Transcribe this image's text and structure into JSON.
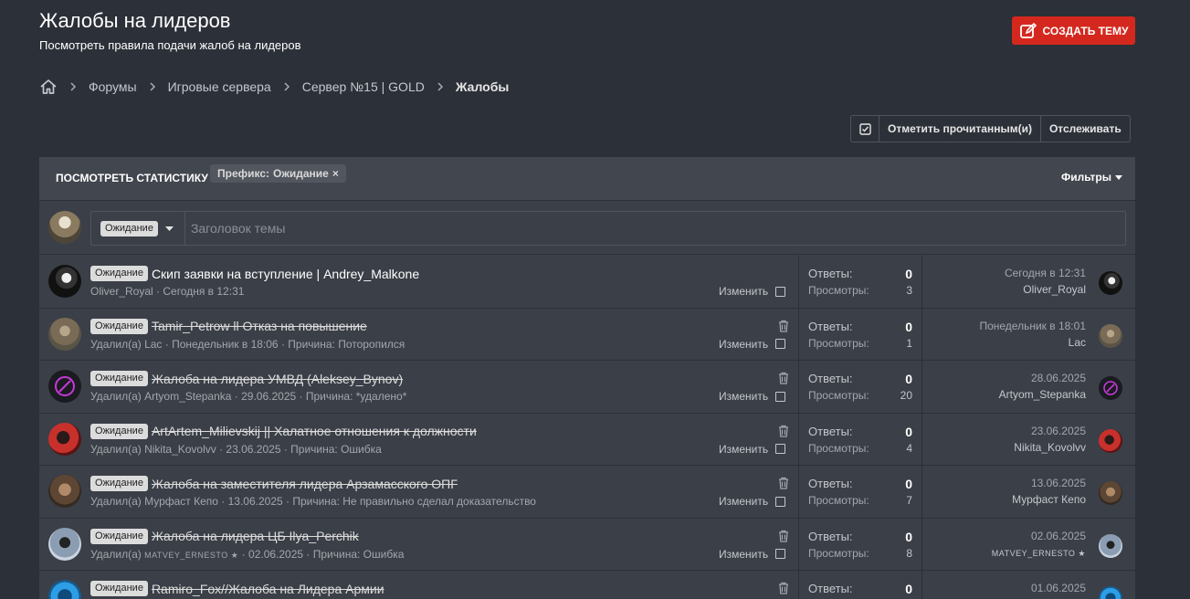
{
  "header": {
    "title": "Жалобы на лидеров",
    "description": "Посмотреть правила подачи жалоб на лидеров",
    "create_button": "СОЗДАТЬ ТЕМУ"
  },
  "breadcrumb": [
    "Форумы",
    "Игровые сервера",
    "Сервер №15 | GOLD",
    "Жалобы"
  ],
  "actions": {
    "mark_read": "Отметить прочитанным(и)",
    "watch": "Отслеживать"
  },
  "filter_bar": {
    "stats_link": "ПОСМОТРЕТЬ СТАТИСТИКУ",
    "prefix_label": "Префикс:",
    "prefix_value": "Ожидание",
    "remove": "×",
    "filters": "Фильтры"
  },
  "new_thread": {
    "prefix": "Ожидание",
    "placeholder": "Заголовок темы"
  },
  "labels": {
    "replies": "Ответы:",
    "views": "Просмотры:",
    "edit": "Изменить"
  },
  "threads": [
    {
      "prefix": "Ожидание",
      "title": "Скип заявки на вступление | Andrey_Malkone",
      "meta": "Oliver_Royal · Сегодня в 12:31",
      "replies": "0",
      "views": "3",
      "last_date": "Сегодня в 12:31",
      "last_user": "Oliver_Royal"
    },
    {
      "prefix": "Ожидание",
      "title": "Tamir_Petrow ll Отказ на повышение",
      "meta": "Удалил(а) Lac · Понедельник в 18:06 · Причина: Поторопился",
      "replies": "0",
      "views": "1",
      "last_date": "Понедельник в 18:01",
      "last_user": "Lac"
    },
    {
      "prefix": "Ожидание",
      "title": "Жалоба на лидера УМВД (Aleksey_Bynov)",
      "meta": "Удалил(а) Artyom_Stepanka · 29.06.2025 · Причина: *удалено*",
      "replies": "0",
      "views": "20",
      "last_date": "28.06.2025",
      "last_user": "Artyom_Stepanka"
    },
    {
      "prefix": "Ожидание",
      "title": "ArtArtem_Milievskij || Халатное отношения к должности",
      "meta": "Удалил(а) Nikita_Kovolvv · 23.06.2025 · Причина: Ошибка",
      "replies": "0",
      "views": "4",
      "last_date": "23.06.2025",
      "last_user": "Nikita_Kovolvv"
    },
    {
      "prefix": "Ожидание",
      "title": "Жалоба на заместителя лидера Арзамасского ОПГ",
      "meta": "Удалил(а) Мурфаст Кепо · 13.06.2025 · Причина: Не правильно сделал доказательство",
      "replies": "0",
      "views": "7",
      "last_date": "13.06.2025",
      "last_user": "Мурфаст Кепо"
    },
    {
      "prefix": "Ожидание",
      "title": "Жалоба на лидера ЦБ Ilya_Perchik",
      "meta_pre": "Удалил(а)",
      "meta_user": "MATVEY_ERNESTO ★",
      "meta_post": "· 02.06.2025 · Причина: Ошибка",
      "replies": "0",
      "views": "8",
      "last_date": "02.06.2025",
      "last_user": "MATVEY_ERNESTO ★"
    },
    {
      "prefix": "Ожидание",
      "title": "Ramiro_Fox//Жалоба на Лидера Армии",
      "replies": "0",
      "last_date": "01.06.2025"
    }
  ],
  "colors": {
    "background": "#2c3038",
    "panel": "#3b3f47",
    "accent_button": "#d4281e"
  }
}
